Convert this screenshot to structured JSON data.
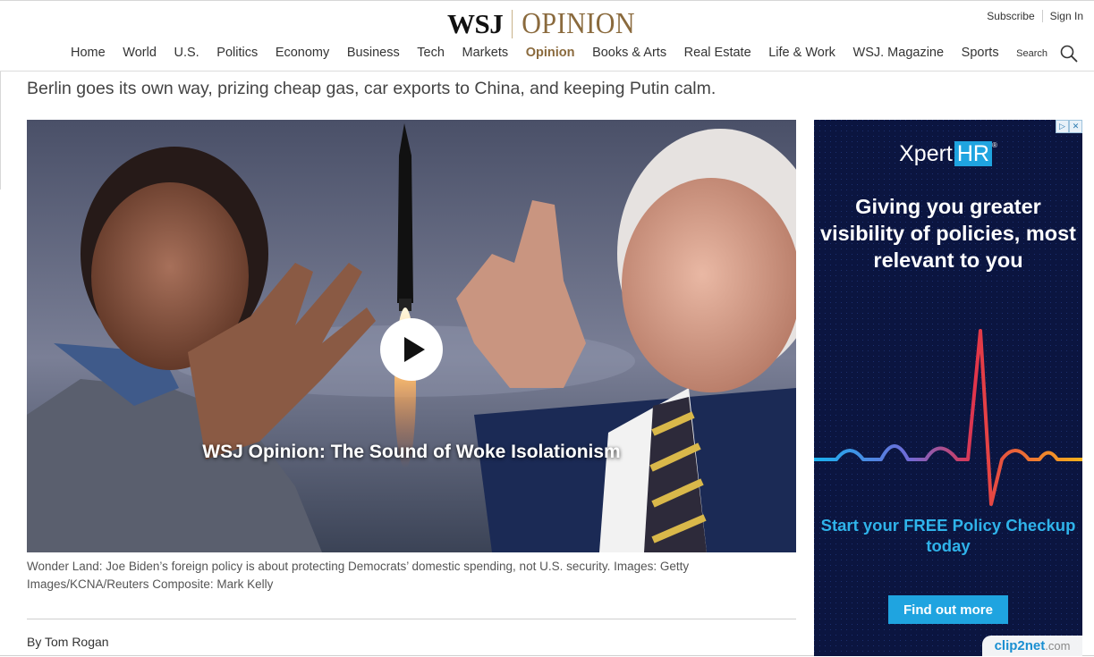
{
  "header": {
    "logo_wsj": "WSJ",
    "logo_section": "OPINION",
    "subscribe": "Subscribe",
    "sign_in": "Sign In",
    "search_label": "Search",
    "nav": [
      "Home",
      "World",
      "U.S.",
      "Politics",
      "Economy",
      "Business",
      "Tech",
      "Markets",
      "Opinion",
      "Books & Arts",
      "Real Estate",
      "Life & Work",
      "WSJ. Magazine",
      "Sports"
    ],
    "active_nav": "Opinion"
  },
  "article": {
    "deck": "Berlin goes its own way, prizing cheap gas, car exports to China, and keeping Putin calm.",
    "video_title": "WSJ Opinion: The Sound of Woke Isolationism",
    "caption": "Wonder Land: Joe Biden’s foreign policy is about protecting Democrats’ domestic spending, not U.S. security. Images: Getty Images/KCNA/Reuters Composite: Mark Kelly",
    "byline_prefix": "By",
    "author": "Tom Rogan"
  },
  "ad": {
    "brand_main": "Xpert",
    "brand_accent": "HR",
    "brand_mark": "®",
    "headline": "Giving you greater visibility of policies, most relevant to you",
    "cta_text": "Start your FREE Policy Checkup today",
    "button": "Find out more",
    "adchoices_icons": [
      "ad-info-icon",
      "ad-close-icon"
    ]
  },
  "watermark": {
    "name": "clip2net",
    "domain": ".com"
  },
  "colors": {
    "opinion_accent": "#8a6a3d",
    "ad_background": "#0b1540",
    "ad_accent": "#1fa4e0"
  }
}
